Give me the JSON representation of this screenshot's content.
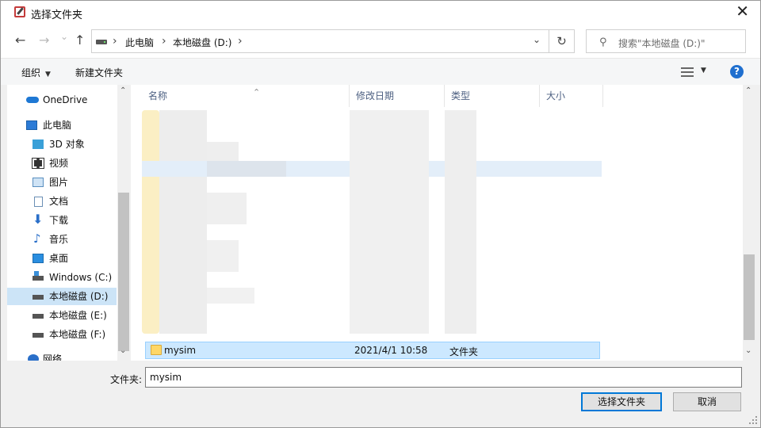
{
  "window": {
    "title": "选择文件夹",
    "close_glyph": "✕"
  },
  "nav": {
    "back_glyph": "←",
    "forward_glyph": "→",
    "recent_glyph": "⌄",
    "up_glyph": "↑",
    "breadcrumbs": [
      "此电脑",
      "本地磁盘 (D:)"
    ],
    "crumb_sep": "›",
    "refresh_glyph": "↻",
    "dropdown_glyph": "⌄"
  },
  "search": {
    "placeholder": "搜索\"本地磁盘 (D:)\"",
    "icon_glyph": "⚲"
  },
  "toolbar": {
    "organize_label": "组织",
    "organize_caret": "▼",
    "new_folder_label": "新建文件夹",
    "view_caret": "▼",
    "help_glyph": "?"
  },
  "sidebar": {
    "items": [
      {
        "label": "OneDrive",
        "icon": "onedrive-icon",
        "color": "#1e78d4"
      },
      {
        "label": "此电脑",
        "icon": "computer-icon",
        "color": "#2c7bd6"
      },
      {
        "label": "3D 对象",
        "icon": "3d-objects-icon",
        "color": "#3aa0d8"
      },
      {
        "label": "视频",
        "icon": "video-icon",
        "color": "#333333"
      },
      {
        "label": "图片",
        "icon": "pictures-icon",
        "color": "#5a8fc0"
      },
      {
        "label": "文档",
        "icon": "documents-icon",
        "color": "#6b8fb5"
      },
      {
        "label": "下载",
        "icon": "download-icon",
        "color": "#2a6fc9"
      },
      {
        "label": "音乐",
        "icon": "music-icon",
        "color": "#2a6fc9"
      },
      {
        "label": "桌面",
        "icon": "desktop-icon",
        "color": "#2a8ee0"
      },
      {
        "label": "Windows  (C:)",
        "icon": "windows-drive-icon",
        "color": "#3a8fd9"
      },
      {
        "label": "本地磁盘 (D:)",
        "icon": "drive-icon",
        "color": "#555555",
        "selected": true
      },
      {
        "label": "本地磁盘 (E:)",
        "icon": "drive-icon",
        "color": "#555555"
      },
      {
        "label": "本地磁盘 (F:)",
        "icon": "drive-icon",
        "color": "#555555"
      },
      {
        "label": "网络",
        "icon": "network-icon",
        "color": "#2a6fc9"
      }
    ],
    "scroll_up": "⌃",
    "scroll_down": "⌄"
  },
  "filelist": {
    "columns": [
      "名称",
      "修改日期",
      "类型",
      "大小"
    ],
    "sort_caret": "⌃",
    "selected_row": {
      "name": "mysim",
      "modified": "2021/4/1 10:58",
      "type": "文件夹",
      "size": ""
    },
    "scroll_up": "⌃",
    "scroll_down": "⌄"
  },
  "footer": {
    "folder_label": "文件夹:",
    "folder_value": "mysim",
    "select_label": "选择文件夹",
    "cancel_label": "取消"
  },
  "colors": {
    "accent": "#0078d7",
    "selection": "#cce8ff",
    "folder": "#ffd767"
  }
}
